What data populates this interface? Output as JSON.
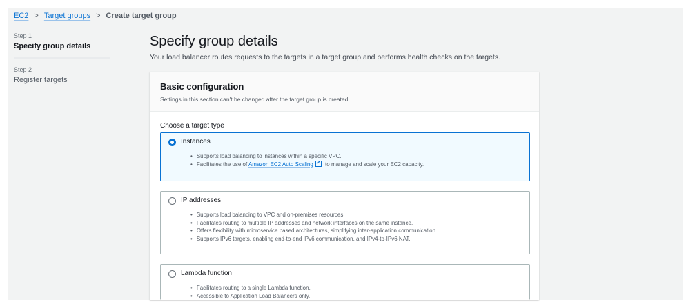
{
  "breadcrumb": {
    "items": [
      "EC2",
      "Target groups"
    ],
    "current": "Create target group"
  },
  "steps": [
    {
      "number": "Step 1",
      "title": "Specify group details"
    },
    {
      "number": "Step 2",
      "title": "Register targets"
    }
  ],
  "page": {
    "title": "Specify group details",
    "subtitle": "Your load balancer routes requests to the targets in a target group and performs health checks on the targets."
  },
  "card": {
    "title": "Basic configuration",
    "description": "Settings in this section can't be changed after the target group is created.",
    "choose_label": "Choose a target type"
  },
  "options": [
    {
      "label": "Instances",
      "selected": true,
      "bullets": [
        "Supports load balancing to instances within a specific VPC."
      ],
      "bullet2_prefix": "Facilitates the use of",
      "bullet2_link": "Amazon EC2 Auto Scaling",
      "bullet2_suffix": "to manage and scale your EC2 capacity."
    },
    {
      "label": "IP addresses",
      "selected": false,
      "bullets": [
        "Supports load balancing to VPC and on-premises resources.",
        "Facilitates routing to multiple IP addresses and network interfaces on the same instance.",
        "Offers flexibility with microservice based architectures, simplifying inter-application communication.",
        "Supports IPv6 targets, enabling end-to-end IPv6 communication, and IPv4-to-IPv6 NAT."
      ]
    },
    {
      "label": "Lambda function",
      "selected": false,
      "bullets": [
        "Facilitates routing to a single Lambda function.",
        "Accessible to Application Load Balancers only."
      ]
    }
  ]
}
